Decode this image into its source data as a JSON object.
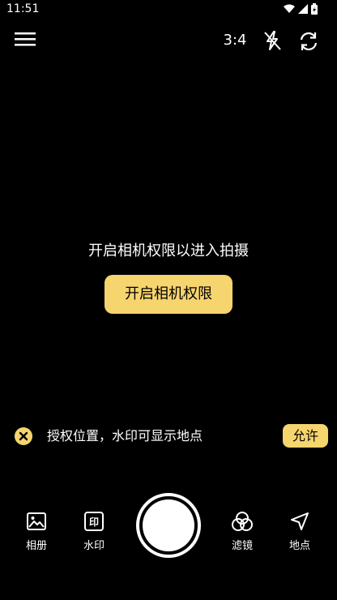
{
  "status_bar": {
    "time": "11:51",
    "icons": [
      "wifi-icon",
      "signal-icon",
      "battery-charging-icon"
    ]
  },
  "top_bar": {
    "menu_icon": "menu-icon",
    "aspect_ratio": "3:4",
    "flash_icon": "flash-off-icon",
    "switch_camera_icon": "camera-switch-icon"
  },
  "permission": {
    "message": "开启相机权限以进入拍摄",
    "button_label": "开启相机权限"
  },
  "location_banner": {
    "text": "授权位置，水印可显示地点",
    "allow_label": "允许"
  },
  "bottom_tools": {
    "album": "相册",
    "watermark": "水印",
    "filter": "滤镜",
    "location": "地点"
  },
  "colors": {
    "accent": "#f6d46e",
    "background": "#000000",
    "text": "#ffffff"
  }
}
